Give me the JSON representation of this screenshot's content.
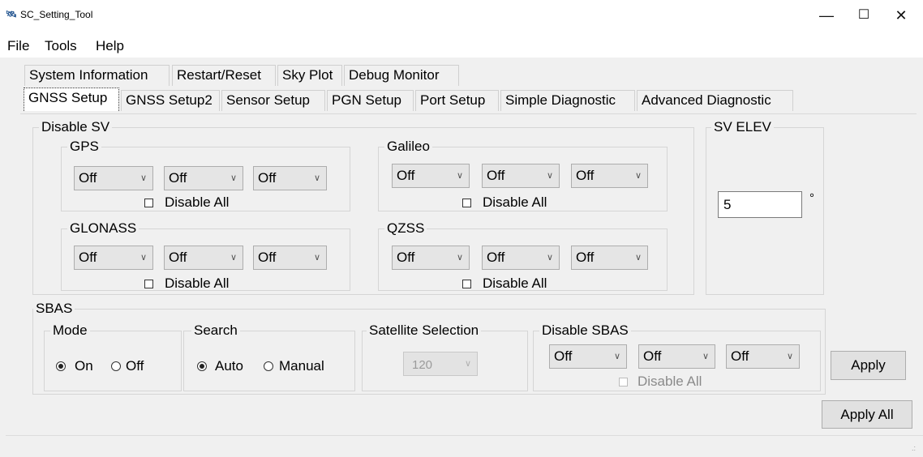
{
  "window": {
    "title": "SC_Setting_Tool",
    "minimize_glyph": "—",
    "maximize_glyph": "☐",
    "close_glyph": "✕"
  },
  "menu": [
    "File",
    "Tools",
    "Help"
  ],
  "tabs_row1": [
    "System Information",
    "Restart/Reset",
    "Sky Plot",
    "Debug Monitor"
  ],
  "tabs_row2": [
    "GNSS Setup",
    "GNSS Setup2",
    "Sensor Setup",
    "PGN Setup",
    "Port Setup",
    "Simple Diagnostic",
    "Advanced Diagnostic"
  ],
  "active_tab": "GNSS Setup",
  "disable_sv": {
    "title": "Disable SV",
    "gps": {
      "title": "GPS",
      "combos": [
        "Off",
        "Off",
        "Off"
      ],
      "disable_all": "Disable All"
    },
    "galileo": {
      "title": "Galileo",
      "combos": [
        "Off",
        "Off",
        "Off"
      ],
      "disable_all": "Disable All"
    },
    "glonass": {
      "title": "GLONASS",
      "combos": [
        "Off",
        "Off",
        "Off"
      ],
      "disable_all": "Disable All"
    },
    "qzss": {
      "title": "QZSS",
      "combos": [
        "Off",
        "Off",
        "Off"
      ],
      "disable_all": "Disable All"
    }
  },
  "sv_elev": {
    "title": "SV ELEV",
    "value": "5",
    "unit": "°"
  },
  "sbas": {
    "title": "SBAS",
    "mode": {
      "title": "Mode",
      "on": "On",
      "off": "Off",
      "selected": "On"
    },
    "search": {
      "title": "Search",
      "auto": "Auto",
      "manual": "Manual",
      "selected": "Auto"
    },
    "satellite_selection": {
      "title": "Satellite Selection",
      "value": "120"
    },
    "disable_sbas": {
      "title": "Disable SBAS",
      "combos": [
        "Off",
        "Off",
        "Off"
      ],
      "disable_all": "Disable All"
    }
  },
  "buttons": {
    "apply": "Apply",
    "apply_all": "Apply All"
  },
  "icons": {
    "app": "satellite-app-icon",
    "combo_arrow": "chevron-down-icon",
    "grip": "size-grip-icon"
  }
}
